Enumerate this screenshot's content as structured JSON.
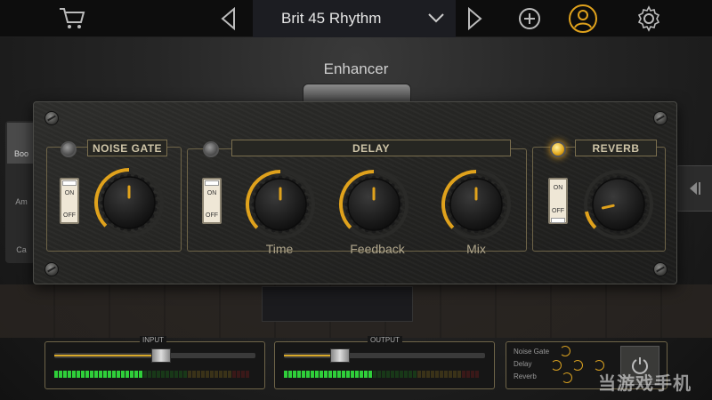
{
  "header": {
    "preset_name": "Brit 45 Rhythm",
    "icons": [
      "cart-icon",
      "previous-icon",
      "dropdown-icon",
      "next-icon",
      "add-icon",
      "user-icon",
      "settings-icon"
    ]
  },
  "fx_title": "Enhancer",
  "side_tabs": [
    "Boo",
    "Am",
    "Ca"
  ],
  "panel": {
    "noise_gate": {
      "label": "NOISE GATE",
      "led_on": false,
      "switch": {
        "on": "ON",
        "off": "OFF",
        "state": "on"
      },
      "knob_value": 0.5
    },
    "delay": {
      "label": "DELAY",
      "led_on": false,
      "switch": {
        "on": "ON",
        "off": "OFF",
        "state": "on"
      },
      "knobs": [
        {
          "label": "Time",
          "value": 0.5
        },
        {
          "label": "Feedback",
          "value": 0.5
        },
        {
          "label": "Mix",
          "value": 0.5
        }
      ]
    },
    "reverb": {
      "label": "REVERB",
      "led_on": true,
      "switch": {
        "on": "ON",
        "off": "OFF",
        "state": "off"
      },
      "knob_value": 0.12
    }
  },
  "meters": {
    "input": {
      "label": "INPUT",
      "level": 0.53
    },
    "output": {
      "label": "OUTPUT",
      "level": 0.28
    }
  },
  "mini": {
    "labels": [
      "Noise Gate",
      "Delay",
      "Reverb"
    ]
  },
  "watermark": "当游戏手机",
  "colors": {
    "accent": "#e0a21c",
    "panel_border": "#6e6448",
    "led_on": "#e3a81c"
  }
}
